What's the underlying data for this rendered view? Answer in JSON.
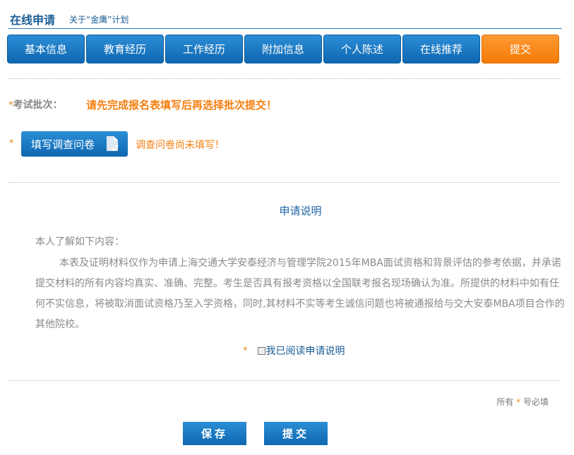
{
  "header": {
    "title": "在线申请",
    "subtitle": "关于“金鹰”计划"
  },
  "tabs": [
    {
      "label": "基本信息",
      "active": false
    },
    {
      "label": "教育经历",
      "active": false
    },
    {
      "label": "工作经历",
      "active": false
    },
    {
      "label": "附加信息",
      "active": false
    },
    {
      "label": "个人陈述",
      "active": false
    },
    {
      "label": "在线推荐",
      "active": false
    },
    {
      "label": "提交",
      "active": true
    }
  ],
  "required_mark": "*",
  "batch": {
    "label": "考试批次：",
    "message": "请先完成报名表填写后再选择批次提交！"
  },
  "survey": {
    "button_label": "填写调查问卷",
    "note": "调查问卷尚未填写！",
    "icon": "document-icon"
  },
  "explanation": {
    "title": "申请说明",
    "intro": "本人了解如下内容：",
    "body": "本表及证明材料仅作为申请上海交通大学安泰经济与管理学院2015年MBA面试资格和背景评估的参考依据，并承诺提交材料的所有内容均真实、准确、完整。考生是否具有报考资格以全国联考报名现场确认为准。所提供的材料中如有任何不实信息，将被取消面试资格乃至入学资格，同时,其材料不实等考生诚信问题也将被通报给与交大安泰MBA项目合作的其他院校。",
    "agree_label": "我已阅读申请说明",
    "agree_checked": false
  },
  "footer": {
    "required_prefix": "所有",
    "required_suffix": "号必填",
    "save_label": "保存",
    "submit_label": "提交"
  },
  "colors": {
    "primary": "#1a72bd",
    "accent": "#f47a06",
    "warning": "#f57f10"
  }
}
